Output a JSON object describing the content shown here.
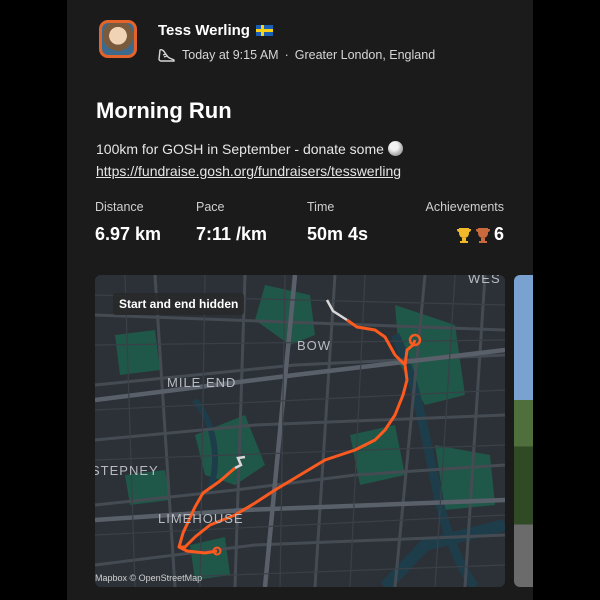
{
  "athlete": {
    "name": "Tess Werling",
    "flag_icon": "sweden-flag-icon",
    "timestamp": "Today at 9:15 AM",
    "location": "Greater London, England",
    "activity_icon": "shoe-icon"
  },
  "activity": {
    "title": "Morning Run",
    "description": "100km for GOSH in September - donate some",
    "description_icon": "moon-icon",
    "link": "https://fundraise.gosh.org/fundraisers/tesswerling"
  },
  "stats": [
    {
      "label": "Distance",
      "value": "6.97 km"
    },
    {
      "label": "Pace",
      "value": "7:11 /km"
    },
    {
      "label": "Time",
      "value": "50m 4s"
    }
  ],
  "achievements": {
    "label": "Achievements",
    "count": "6",
    "icons": [
      "gold-trophy-icon",
      "bronze-trophy-icon"
    ]
  },
  "map": {
    "badge": "Start and end hidden",
    "attribution": "Mapbox © OpenStreetMap",
    "labels": [
      "BOW",
      "MILE END",
      "STEPNEY",
      "LIMEHOUSE",
      "WES"
    ],
    "route_color": "#fc5a1f"
  },
  "colors": {
    "accent": "#fc5a1f",
    "background": "#1b1b1b"
  }
}
